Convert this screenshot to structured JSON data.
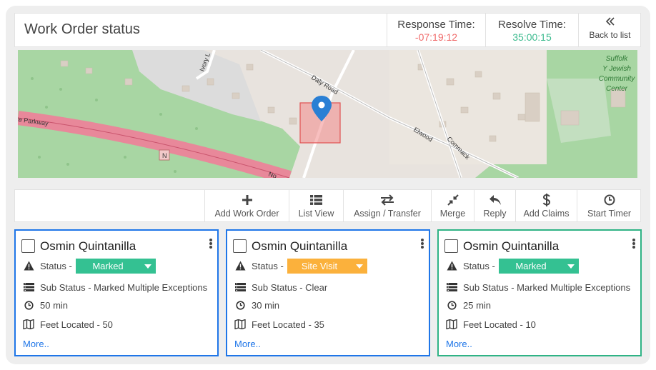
{
  "header": {
    "title": "Work Order status",
    "response_label": "Response Time:",
    "response_value": "-07:19:12",
    "resolve_label": "Resolve Time:",
    "resolve_value": "35:00:15",
    "back_label": "Back to list",
    "back_icon": "double-chevron-left-icon"
  },
  "map": {
    "labels": {
      "ivory": "Ivory L",
      "daly": "Daly Road",
      "parkway": "te Parkway",
      "elwood": "Elwood",
      "commack": "Commack",
      "no": "No",
      "shield": "N",
      "center1": "Suffolk",
      "center2": "Y Jewish",
      "center3": "Community",
      "center4": "Center"
    },
    "colors": {
      "park": "#a8d6a3",
      "highway": "#e8889a",
      "selection": "#f28b8b",
      "pin": "#2a7fd4"
    }
  },
  "toolbar": [
    {
      "label": "Add Work Order",
      "icon": "plus-icon"
    },
    {
      "label": "List View",
      "icon": "list-icon"
    },
    {
      "label": "Assign / Transfer",
      "icon": "transfer-arrows-icon"
    },
    {
      "label": "Merge",
      "icon": "merge-icon"
    },
    {
      "label": "Reply",
      "icon": "reply-icon"
    },
    {
      "label": "Add Claims",
      "icon": "dollar-icon"
    },
    {
      "label": "Start Timer",
      "icon": "clock-icon"
    }
  ],
  "cards": [
    {
      "name": "Osmin Quintanilla",
      "status_prefix": "Status -",
      "status": "Marked",
      "sub_status": "Sub Status - Marked Multiple Exceptions",
      "duration": "50 min",
      "feet": "Feet Located - 50",
      "more": "More.."
    },
    {
      "name": "Osmin Quintanilla",
      "status_prefix": "Status -",
      "status": "Site Visit",
      "sub_status": "Sub Status - Clear",
      "duration": "30 min",
      "feet": "Feet Located - 35",
      "more": "More.."
    },
    {
      "name": "Osmin Quintanilla",
      "status_prefix": "Status -",
      "status": "Marked",
      "sub_status": "Sub Status - Marked Multiple Exceptions",
      "duration": "25 min",
      "feet": "Feet Located - 10",
      "more": "More.."
    }
  ]
}
